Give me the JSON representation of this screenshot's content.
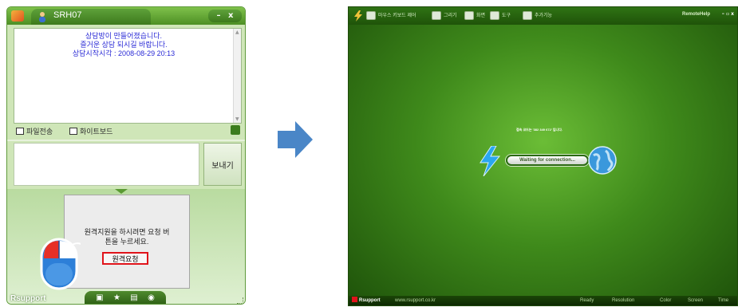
{
  "chat_window": {
    "username": "SRH07",
    "window_controls": {
      "minimize": "–",
      "close": "x"
    },
    "messages": [
      "상담방이 만들어졌습니다.",
      "즐거운 상담 되시길 바랍니다.",
      "상담시작시각 : 2008-08-29 20:13"
    ],
    "tools": {
      "file_transfer": "파일전송",
      "whiteboard": "화이트보드"
    },
    "input_placeholder": "",
    "send_label": "보내기",
    "request_panel": {
      "text_line1": "원격지원을 하시려면 요청 버",
      "text_line2": "튼을 누르세요.",
      "button_label": "원격요청"
    },
    "brand": "Rsupport",
    "dock_icons": [
      "monitor-icon",
      "star-icon",
      "folder-icon",
      "webcam-icon"
    ]
  },
  "remote_window": {
    "menu": [
      {
        "label": "마우스 키보드 제어",
        "icon": "mouse-keyboard-icon"
      },
      {
        "label": "그리기",
        "icon": "pencil-icon"
      },
      {
        "label": "화면",
        "icon": "screen-icon"
      },
      {
        "label": "도구",
        "icon": "tools-icon"
      },
      {
        "label": "추가기능",
        "icon": "addon-icon"
      }
    ],
    "title": "RemoteHelp",
    "window_controls": {
      "minimize": "–",
      "maximize": "▫",
      "close": "x"
    },
    "connection_label": "접속 코드는 '382 349 672' 입니다.",
    "waiting_text": "Waiting for connection...",
    "status_bar": {
      "brand": "Rsupport",
      "url": "www.rsupport.co.kr",
      "items": [
        "Ready",
        "Resolution",
        "Color",
        "Screen",
        "Time"
      ]
    }
  },
  "colors": {
    "chat_bg": "#cfe6b8",
    "message_text": "#2a2ad6",
    "request_button_border": "#e0141b",
    "remote_bg": "#3f8a1b",
    "arrow": "#4a86c7"
  }
}
